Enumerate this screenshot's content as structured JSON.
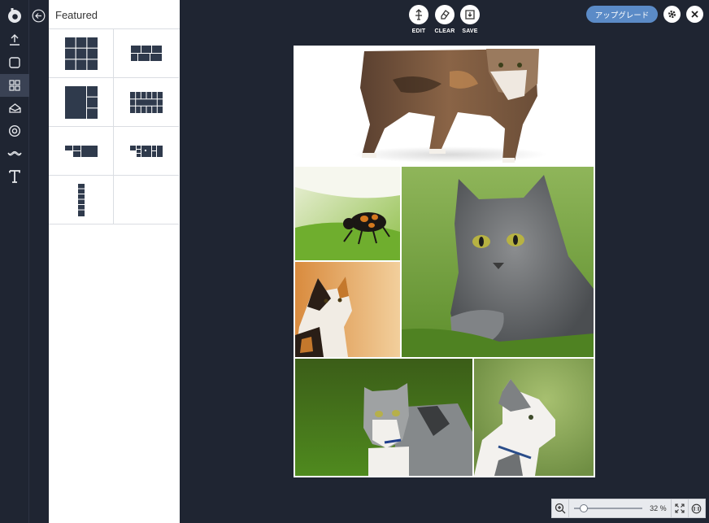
{
  "panel": {
    "title": "Featured",
    "layouts": [
      {
        "name": "grid-3x3"
      },
      {
        "name": "mosaic-wide"
      },
      {
        "name": "big-left-column"
      },
      {
        "name": "grid-4x3-thin"
      },
      {
        "name": "mosaic-small"
      },
      {
        "name": "row-strip"
      },
      {
        "name": "vertical-strip"
      },
      {
        "name": "empty"
      }
    ]
  },
  "toolbar": {
    "edit_label": "EDIT",
    "clear_label": "CLEAR",
    "save_label": "SAVE",
    "upgrade_label": "アップグレード"
  },
  "zoom": {
    "value_label": "32 %",
    "value": 32
  },
  "colors": {
    "background": "#1f2532",
    "accent": "#5b8bc7",
    "panel": "#ffffff"
  },
  "icons": {
    "rail": [
      "logo-icon",
      "upload-icon",
      "square-icon",
      "layout-grid-icon",
      "sticker-icon",
      "circle-target-icon",
      "mustache-icon",
      "text-icon"
    ]
  }
}
